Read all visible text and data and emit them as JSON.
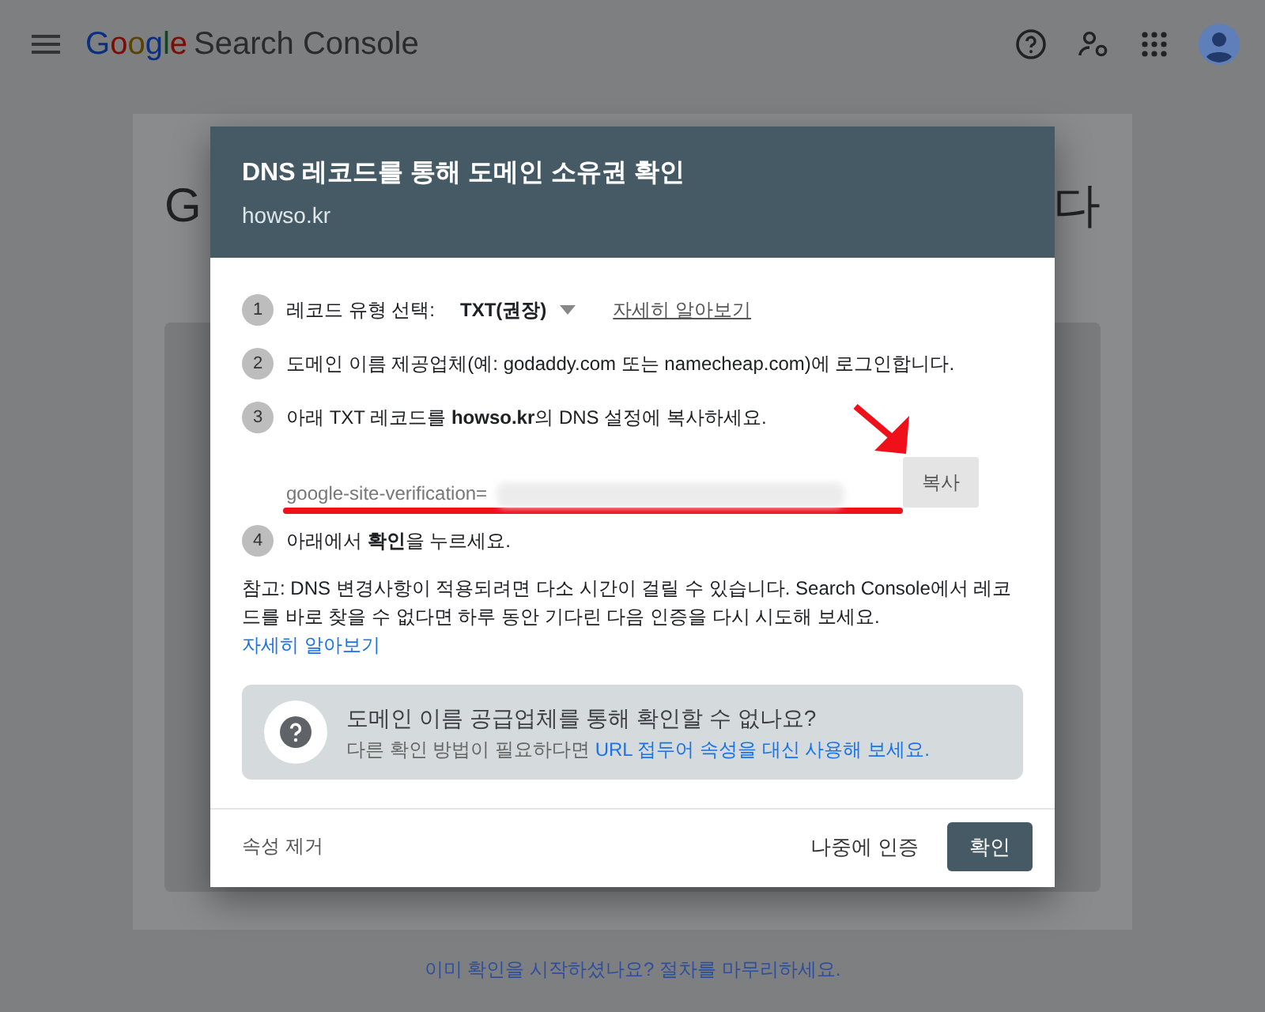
{
  "app_bar": {
    "logo_word": "Google",
    "product": "Search Console"
  },
  "background_page": {
    "heading_start": "G",
    "heading_end": "다",
    "footer_link": "이미 확인을 시작하셨나요? 절차를 마무리하세요."
  },
  "dialog": {
    "title": "DNS 레코드를 통해 도메인 소유권 확인",
    "subtitle": "howso.kr",
    "steps": [
      {
        "number": "1",
        "kind": "select",
        "label": "레코드 유형 선택:",
        "value": "TXT(권장)",
        "link": "자세히 알아보기"
      },
      {
        "number": "2",
        "kind": "text",
        "text": "도메인 이름 제공업체(예: godaddy.com 또는 namecheap.com)에 로그인합니다."
      },
      {
        "number": "3",
        "kind": "text",
        "text": "아래 TXT 레코드를 **howso.kr**의 DNS 설정에 복사하세요."
      },
      {
        "number": "4",
        "kind": "text",
        "text": "아래에서 **확인**을 누르세요."
      }
    ],
    "record": {
      "value": "google-site-verification=",
      "redacted": true,
      "copy_button": "복사",
      "annotated": true
    },
    "note": "참고: DNS 변경사항이 적용되려면 다소 시간이 걸릴 수 있습니다. Search Console에서 레코드를 바로 찾을 수 없다면 하루 동안 기다린 다음 인증을 다시 시도해 보세요.",
    "note_link": "자세히 알아보기",
    "help_box": {
      "title": "도메인 이름 공급업체를 통해 확인할 수 없나요?",
      "text": "다른 확인 방법이 필요하다면",
      "link": "URL 접두어 속성을 대신 사용해 보세요."
    },
    "footer": {
      "remove": "속성 제거",
      "later": "나중에 인증",
      "confirm": "확인"
    }
  }
}
